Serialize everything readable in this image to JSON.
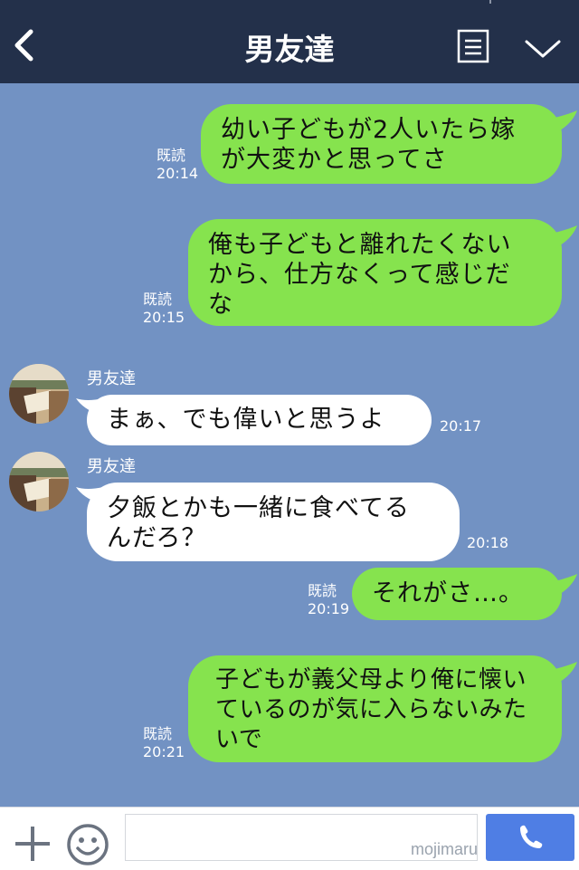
{
  "header": {
    "title": "男友達",
    "back_icon": "back-chevron-icon",
    "menu_icon": "note-list-icon",
    "dropdown_icon": "chevron-down-icon",
    "background": "#23304a"
  },
  "colors": {
    "chat_background": "#7292c3",
    "outgoing_bubble": "#86e34e",
    "incoming_bubble": "#ffffff",
    "send_button": "#4f7ee4"
  },
  "messages": [
    {
      "direction": "outgoing",
      "text": "幼い子どもが2人いたら嫁\nが大変かと思ってさ",
      "read_label": "既読",
      "time": "20:14"
    },
    {
      "direction": "outgoing",
      "text": "俺も子どもと離れたくない\nから、仕方なくって感じだ\nな",
      "read_label": "既読",
      "time": "20:15"
    },
    {
      "direction": "incoming",
      "sender": "男友達",
      "text": "まぁ、でも偉いと思うよ",
      "time": "20:17"
    },
    {
      "direction": "incoming",
      "sender": "男友達",
      "text": "夕飯とかも一緒に食べてる\nんだろ？",
      "time": "20:18"
    },
    {
      "direction": "outgoing",
      "text": "それがさ…。",
      "read_label": "既読",
      "time": "20:19"
    },
    {
      "direction": "outgoing",
      "text": "子どもが義父母より俺に懐い\nているのが気に入らないみた\nいで",
      "read_label": "既読",
      "time": "20:21"
    }
  ],
  "input_bar": {
    "plus_icon": "plus-icon",
    "emoji_icon": "smiley-icon",
    "call_icon": "phone-icon",
    "input_value": ""
  },
  "watermark": "mojimaru"
}
